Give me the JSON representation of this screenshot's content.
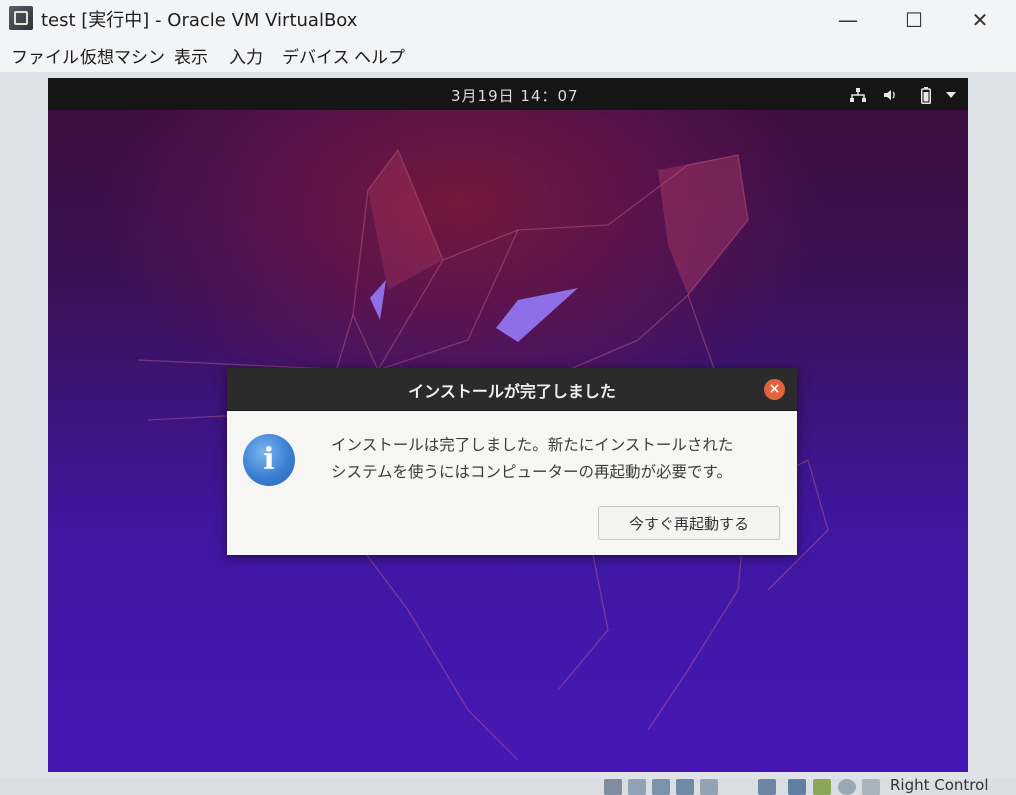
{
  "window": {
    "title": "test [実行中] - Oracle VM VirtualBox",
    "controls": {
      "minimize": "—",
      "maximize": "☐",
      "close": "✕"
    }
  },
  "menu": {
    "items": [
      "ファイル",
      "仮想マシン",
      "表示",
      "入力",
      "デバイス",
      "ヘルプ"
    ]
  },
  "top_bar": {
    "clock": "3月19日 14：07",
    "icons": [
      "network-icon",
      "volume-icon",
      "battery-icon",
      "system-menu-arrow-icon"
    ]
  },
  "dialog": {
    "title": "インストールが完了しました",
    "close_symbol": "×",
    "icon": "info-icon",
    "icon_glyph": "i",
    "message_line1": "インストールは完了しました。新たにインストールされた",
    "message_line2": "システムを使うにはコンピューターの再起動が必要です。",
    "button_label": "今すぐ再起動する"
  },
  "statusbar": {
    "host_key": "Right Control"
  },
  "colors": {
    "top_bar": "#151515",
    "dialog_header": "#2b2b2c",
    "dialog_close": "#e2643f",
    "info_icon": "#3a7fd2",
    "wallpaper_top": "#3d0d3a",
    "wallpaper_bottom": "#4717b5"
  }
}
